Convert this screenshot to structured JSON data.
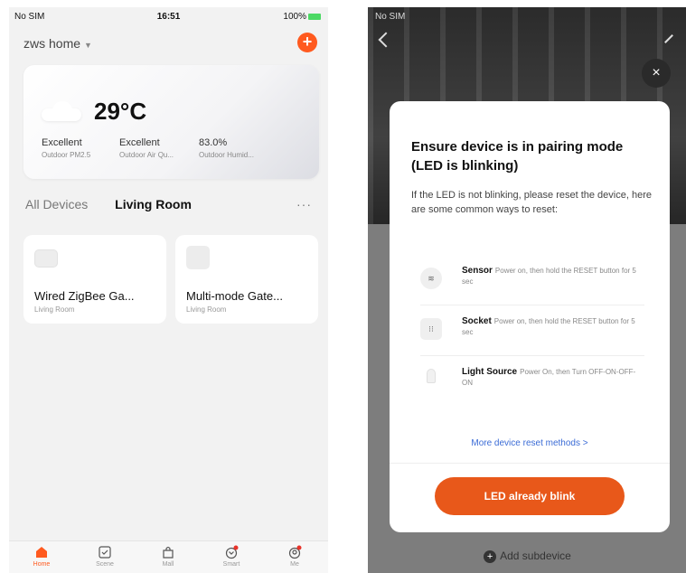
{
  "left": {
    "status": {
      "carrier": "No SIM",
      "time": "16:51",
      "battery": "100%"
    },
    "home": {
      "name": "zws home"
    },
    "add_label": "+",
    "weather": {
      "temp": "29°C",
      "stats": [
        {
          "value": "Excellent",
          "label": "Outdoor PM2.5"
        },
        {
          "value": "Excellent",
          "label": "Outdoor Air Qu..."
        },
        {
          "value": "83.0%",
          "label": "Outdoor Humid..."
        }
      ]
    },
    "tabs": {
      "all": "All Devices",
      "room": "Living Room",
      "more": "···"
    },
    "devices": [
      {
        "name": "Wired ZigBee Ga...",
        "room": "Living Room"
      },
      {
        "name": "Multi-mode Gate...",
        "room": "Living Room"
      }
    ],
    "tabbar": [
      "Home",
      "Scene",
      "Mall",
      "Smart",
      "Me"
    ]
  },
  "right": {
    "status": "No SIM",
    "close": "×",
    "modal": {
      "title": "Ensure device is in pairing mode (LED is blinking)",
      "desc": "If the LED is not blinking, please reset the device, here are some common ways to reset:",
      "methods": [
        {
          "name": "Sensor",
          "text": "Power on, then hold the RESET button for 5 sec"
        },
        {
          "name": "Socket",
          "text": "Power on, then hold the RESET button for 5 sec"
        },
        {
          "name": "Light Source",
          "text": "Power On, then Turn OFF-ON-OFF-ON"
        }
      ],
      "more_link": "More device reset methods >",
      "cta": "LED already blink"
    },
    "add_sub": "Add subdevice"
  },
  "colors": {
    "accent": "#ff5a1f",
    "cta": "#e8581a",
    "link": "#3a6bd6"
  }
}
